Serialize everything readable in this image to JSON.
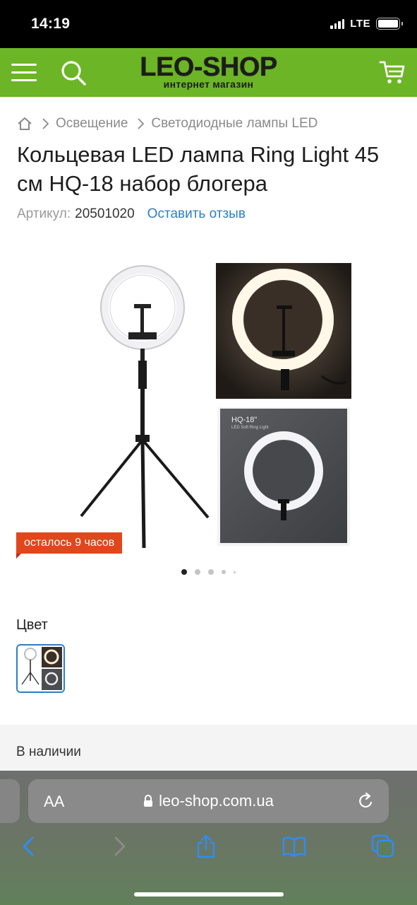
{
  "status": {
    "time": "14:19",
    "network": "LTE"
  },
  "header": {
    "logo_main": "LEO-SHOP",
    "logo_sub": "интернет магазин",
    "brand_color": "#6cb526"
  },
  "breadcrumb": {
    "items": [
      "Освещение",
      "Светодиодные лампы LED"
    ]
  },
  "product": {
    "title": "Кольцевая LED лампа Ring Light 45 см HQ-18 набор блогера",
    "sku_label": "Артикул:",
    "sku_value": "20501020",
    "review_link": "Оставить отзыв",
    "timer_badge": "осталось 9 часов",
    "box_title": "HQ-18\"",
    "box_subtitle": "LED Soft Ring Light",
    "gallery_count": 5,
    "gallery_active": 0
  },
  "options": {
    "color_label": "Цвет"
  },
  "availability": "В наличии",
  "browser": {
    "text_size_label": "AA",
    "url": "leo-shop.com.ua"
  },
  "icons": [
    "menu-icon",
    "search-icon",
    "cart-icon",
    "home-icon",
    "chevron-right-icon",
    "lock-icon",
    "reload-icon",
    "back-icon",
    "forward-icon",
    "share-icon",
    "bookmarks-icon",
    "tabs-icon"
  ],
  "accent_link_color": "#2f7ec2",
  "badge_color": "#e2461c"
}
